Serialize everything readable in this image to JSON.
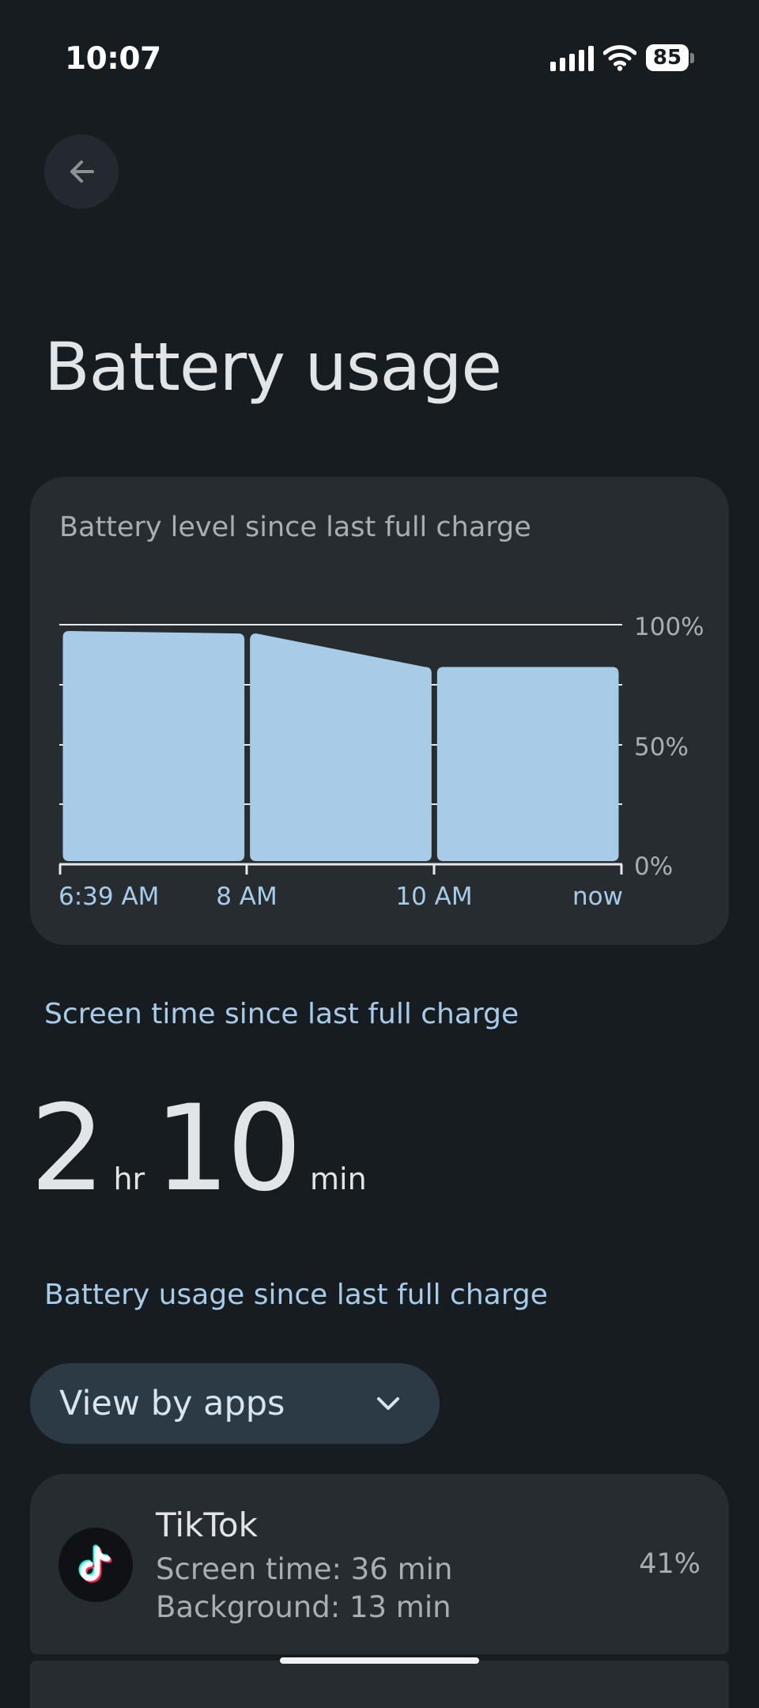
{
  "status_bar": {
    "time": "10:07",
    "battery_level": "85"
  },
  "header": {
    "title": "Battery usage"
  },
  "battery_chart": {
    "title": "Battery level since last full charge",
    "y_labels": [
      "100%",
      "50%",
      "0%"
    ],
    "x_labels": [
      "6:39 AM",
      "8 AM",
      "10 AM",
      "now"
    ],
    "bar_color": "#a8cbe8"
  },
  "chart_data": {
    "type": "area",
    "title": "Battery level since last full charge",
    "ylim": [
      0,
      100
    ],
    "y_ticks": [
      "0%",
      "50%",
      "100%"
    ],
    "x_ticks": [
      "6:39 AM",
      "8 AM",
      "10 AM",
      "now"
    ],
    "segments": [
      {
        "from": "6:39 AM",
        "to": "8 AM",
        "start": 98,
        "end": 97
      },
      {
        "from": "8 AM",
        "to": "10 AM",
        "start": 97,
        "end": 83
      },
      {
        "from": "10 AM",
        "to": "now",
        "start": 83,
        "end": 83
      }
    ]
  },
  "screen_time": {
    "label": "Screen time since last full charge",
    "hours": "2",
    "hours_unit": "hr",
    "minutes": "10",
    "minutes_unit": "min"
  },
  "usage": {
    "label": "Battery usage since last full charge",
    "view_selector": "View by apps",
    "apps": [
      {
        "name": "TikTok",
        "screen_time": "Screen time: 36 min",
        "background": "Background: 13 min",
        "percent": "41%",
        "icon": "tiktok-icon"
      }
    ]
  }
}
